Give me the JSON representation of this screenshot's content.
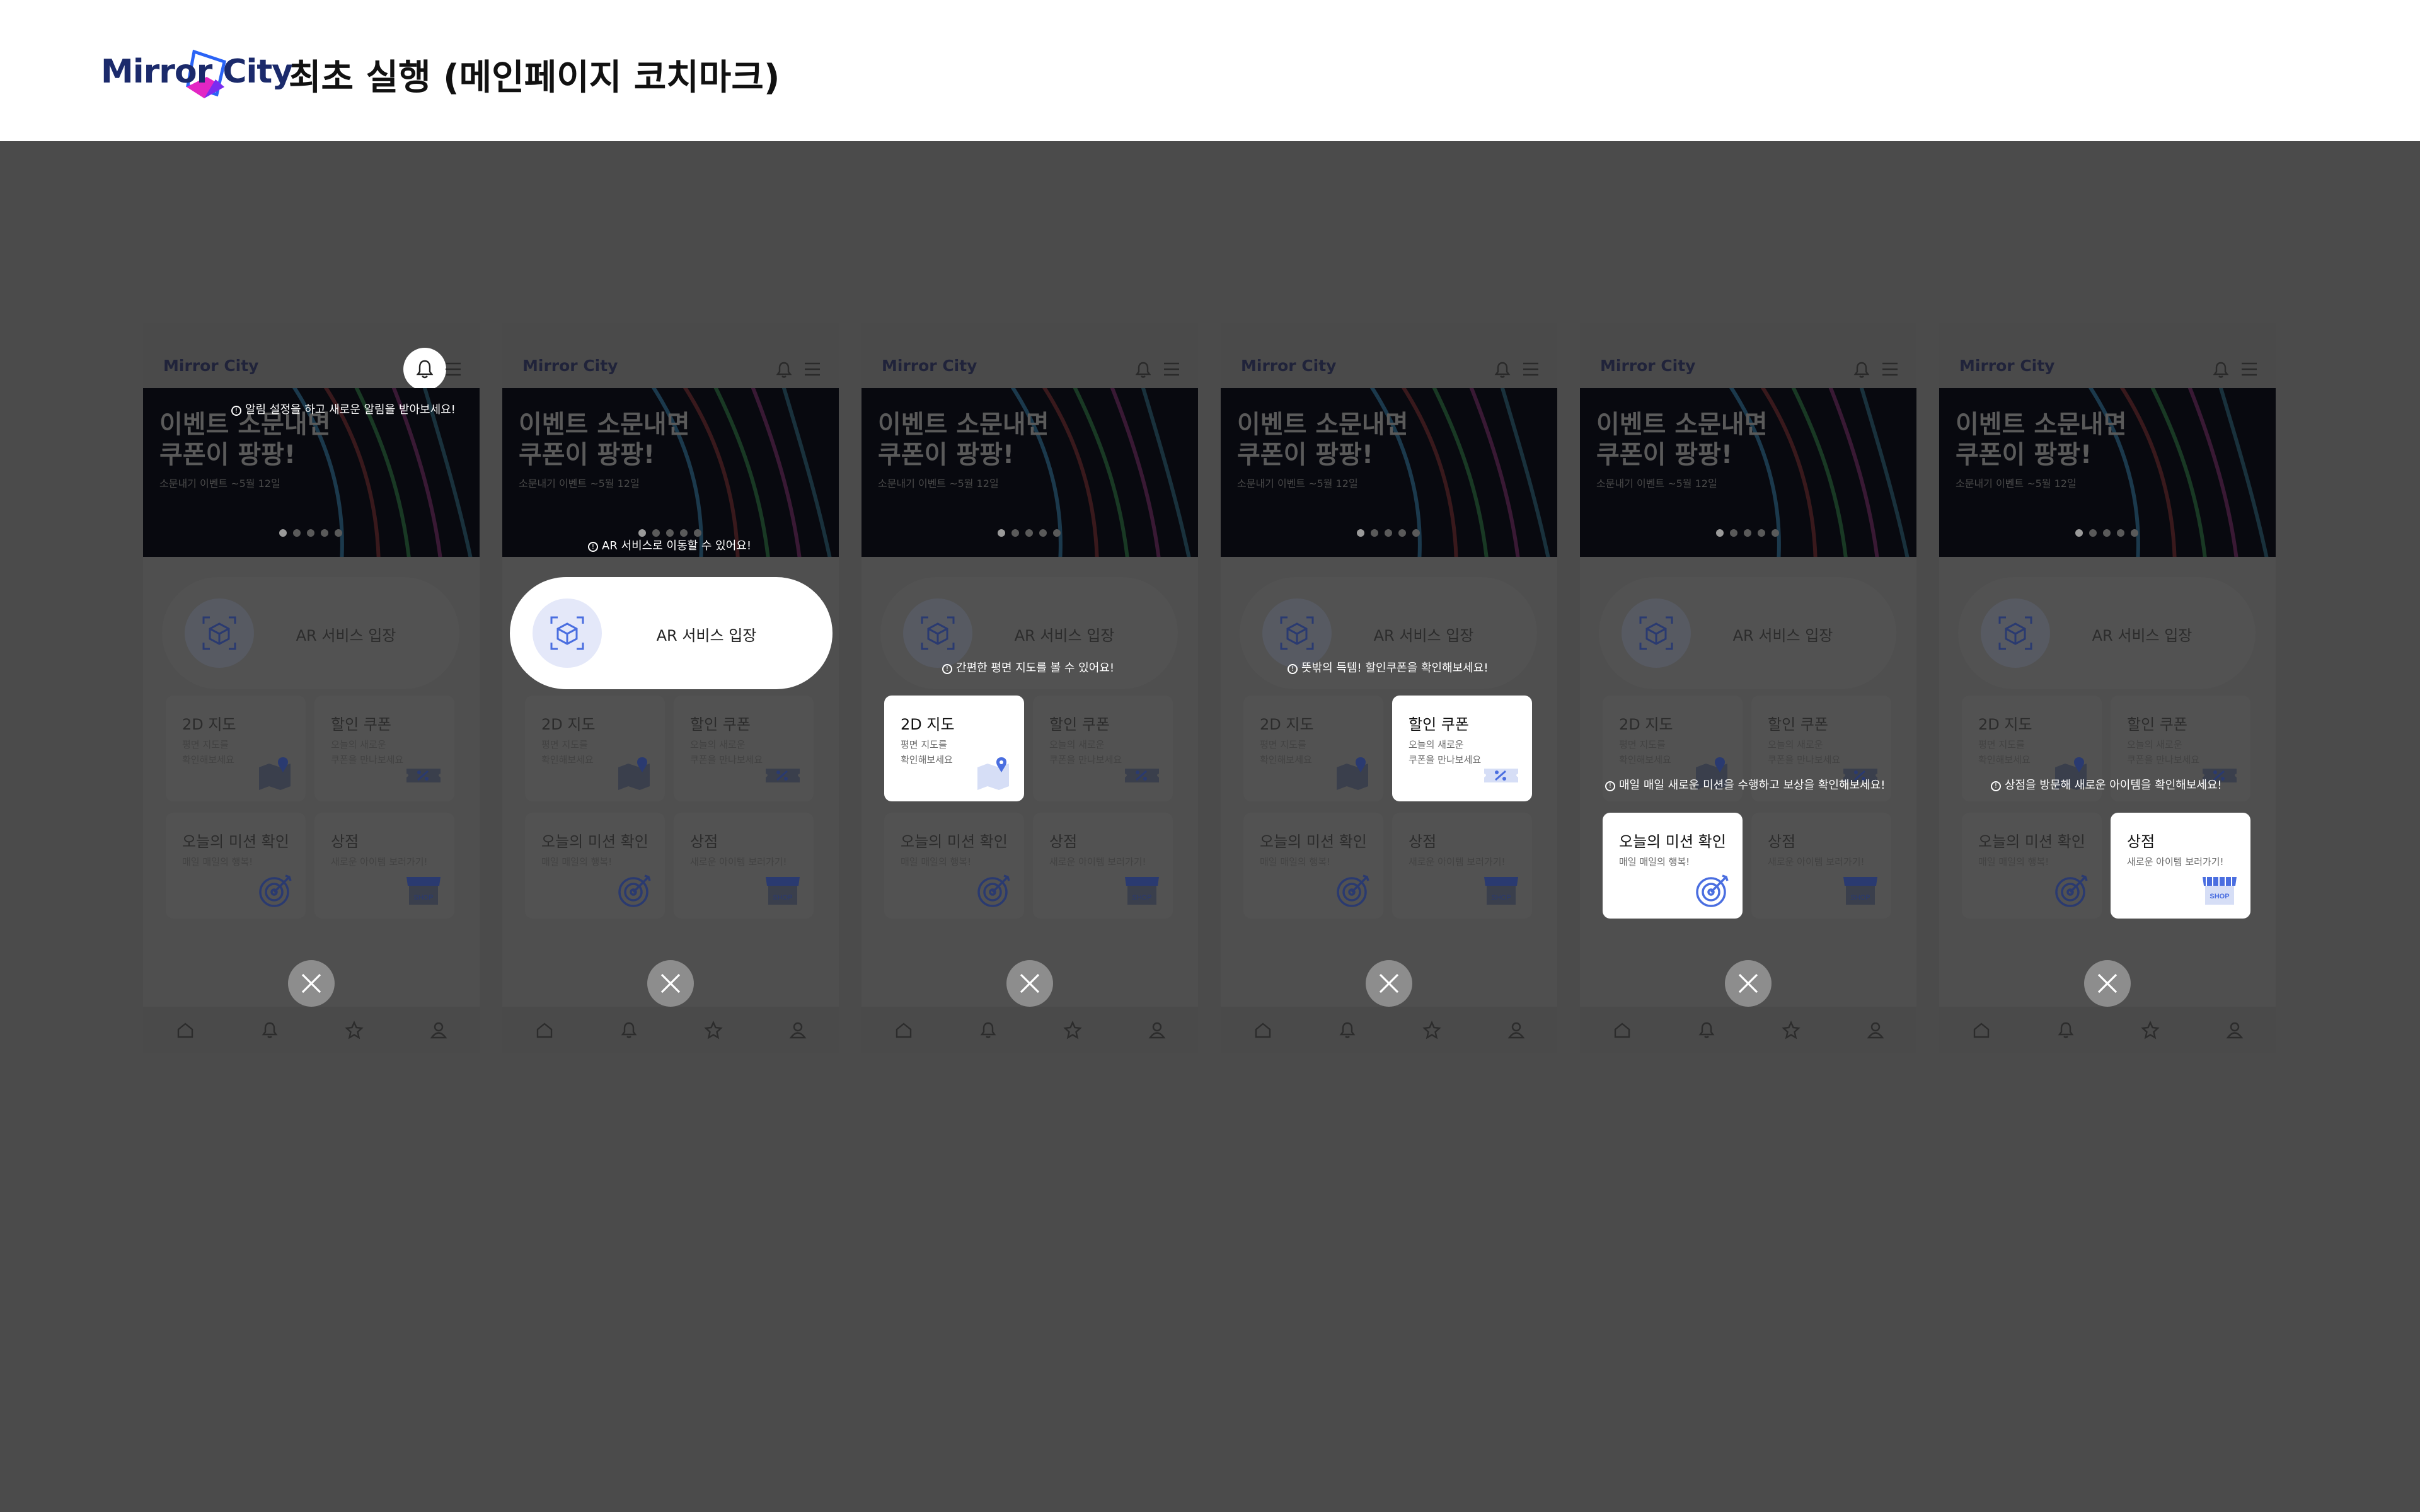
{
  "header": {
    "logo_text": "Mirror City",
    "title": "최초 실행 (메인페이지 코치마크)"
  },
  "screen": {
    "logo": "Mirror City",
    "banner_title": "이벤트 소문내면\n쿠폰이 팡팡!",
    "banner_sub": "소문내기 이벤트 ~5월 12일",
    "ar_label": "AR 서비스 입장",
    "tiles": {
      "map": {
        "title": "2D 지도",
        "desc": "평면 지도를\n확인해보세요"
      },
      "coupon": {
        "title": "할인 쿠폰",
        "desc": "오늘의 새로운\n쿠폰을 만나보세요"
      },
      "mission": {
        "title": "오늘의 미션 확인",
        "desc": "매일 매일의 행복!"
      },
      "shop": {
        "title": "상점",
        "desc": "새로운 아이템 보러가기!"
      }
    }
  },
  "tips": {
    "bell": "알림 설정을 하고 새로운 알림을 받아보세요!",
    "ar": "AR 서비스로 이동할 수 있어요!",
    "map": "간편한 평면 지도를 볼 수 있어요!",
    "coupon": "뜻밖의 득템! 할인쿠폰을 확인해보세요!",
    "mission": "매일 매일 새로운 미션을 수행하고 보상을 확인해보세요!",
    "shop": "상점을 방문해 새로운 아이템을 확인해보세요!"
  },
  "shop_icon_text": "SHOP",
  "colors": {
    "overlay": "#4b4b4b",
    "highlight": "#ffffff",
    "accent": "#4a6ee0",
    "brand": "#1b2a6b"
  },
  "icons": [
    "bell-icon",
    "menu-icon",
    "ar-cube-icon",
    "map-pin-icon",
    "coupon-icon",
    "target-icon",
    "shop-icon",
    "close-icon",
    "home-icon",
    "star-icon",
    "user-icon"
  ]
}
